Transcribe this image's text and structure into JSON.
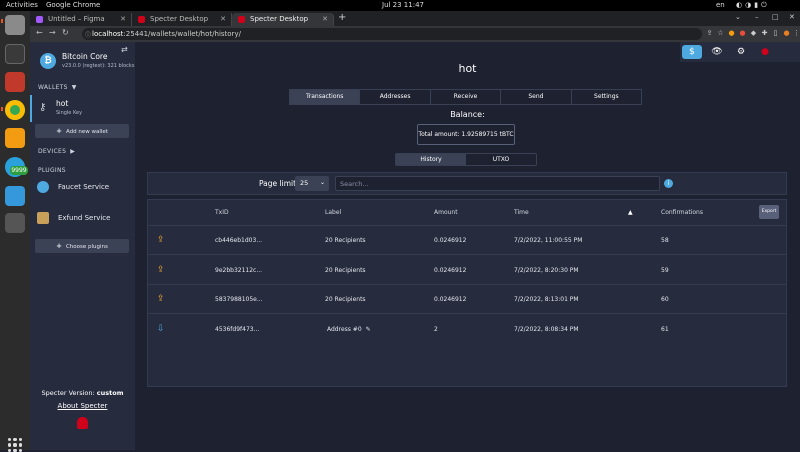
{
  "os": {
    "activities": "Activities",
    "app_name": "Google Chrome",
    "clock": "Jul 23  11:47",
    "lang": "en"
  },
  "browser": {
    "tabs": [
      {
        "title": "Untitled – Figma",
        "active": false
      },
      {
        "title": "Specter Desktop",
        "active": false
      },
      {
        "title": "Specter Desktop",
        "active": true
      }
    ],
    "url_host": "localhost",
    "url_path": ":25441/wallets/wallet/hot/history/"
  },
  "sidebar": {
    "node_title": "Bitcoin Core",
    "node_sub": "v23.0.0 (regtest): 321 blocks",
    "wallets_label": "WALLETS",
    "wallet": {
      "name": "hot",
      "type": "Single Key"
    },
    "add_wallet": "Add new wallet",
    "devices_label": "DEVICES",
    "plugins_label": "PLUGINS",
    "plugins": [
      {
        "name": "Faucet Service"
      },
      {
        "name": "Exfund Service"
      }
    ],
    "choose_plugins": "Choose plugins",
    "version_label": "Specter Version:",
    "version_value": "custom",
    "about": "About Specter"
  },
  "main": {
    "title": "hot",
    "tabs": [
      {
        "label": "Transactions",
        "active": true
      },
      {
        "label": "Addresses",
        "active": false
      },
      {
        "label": "Receive",
        "active": false
      },
      {
        "label": "Send",
        "active": false
      },
      {
        "label": "Settings",
        "active": false
      }
    ],
    "balance_label": "Balance:",
    "balance_text": "Total amount: 1.92589715 tBTC",
    "subtabs": [
      {
        "label": "History",
        "active": true
      },
      {
        "label": "UTXO",
        "active": false
      }
    ],
    "page_limit_label": "Page limit:",
    "page_limit_value": "25",
    "search_placeholder": "Search...",
    "columns": {
      "txid": "TxID",
      "label": "Label",
      "amount": "Amount",
      "time": "Time",
      "confirmations": "Confirmations"
    },
    "export": "Export",
    "rows": [
      {
        "direction": "out",
        "txid": "cb446eb1d03...",
        "label": "20 Recipients",
        "amount": "0.0246912",
        "time": "7/2/2022, 11:00:55 PM",
        "confirmations": "58"
      },
      {
        "direction": "out",
        "txid": "9e2bb32112c...",
        "label": "20 Recipients",
        "amount": "0.0246912",
        "time": "7/2/2022, 8:20:30 PM",
        "confirmations": "59"
      },
      {
        "direction": "out",
        "txid": "5837988105e...",
        "label": "20 Recipients",
        "amount": "0.0246912",
        "time": "7/2/2022, 8:13:01 PM",
        "confirmations": "60"
      },
      {
        "direction": "in",
        "txid": "4536fd9f473...",
        "label": "Address #0",
        "amount": "2",
        "time": "7/2/2022, 8:08:34 PM",
        "confirmations": "61"
      }
    ]
  },
  "colors": {
    "accent": "#4ea9e0",
    "sidebar_bg": "#262b3d",
    "main_bg": "#1e2130",
    "outgoing": "#f0a830"
  }
}
